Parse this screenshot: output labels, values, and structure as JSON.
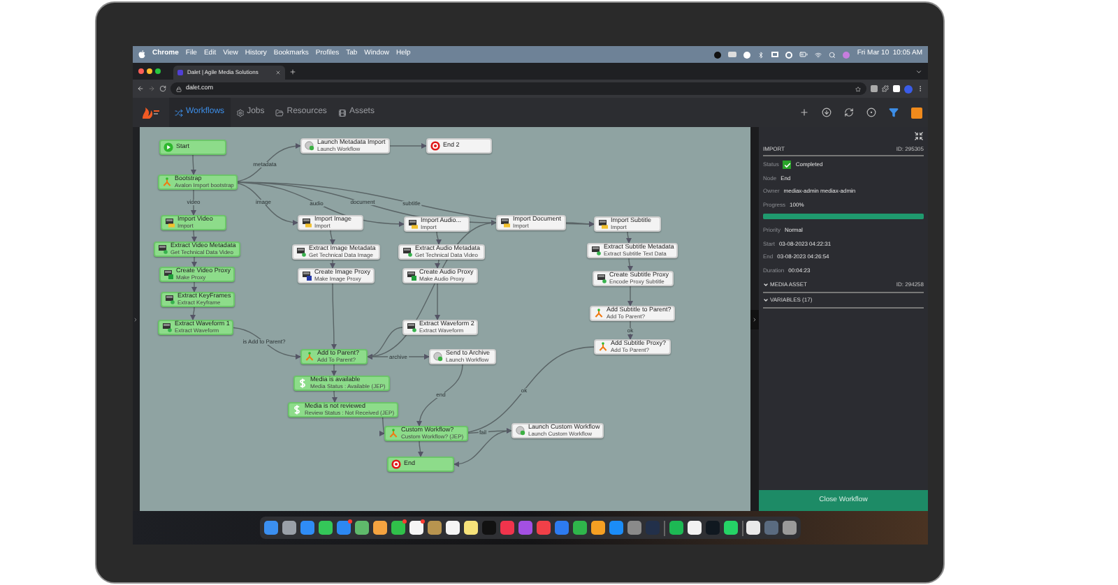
{
  "menu_bar": {
    "app": "Chrome",
    "items": [
      "File",
      "Edit",
      "View",
      "History",
      "Bookmarks",
      "Profiles",
      "Tab",
      "Window",
      "Help"
    ],
    "clock": "Fri Mar 10  10:05 AM"
  },
  "browser": {
    "tabs": [
      {
        "title": "Dalet | Agile Media Solutions",
        "selected": true
      }
    ],
    "url": "dalet.com"
  },
  "app_nav": [
    {
      "label": "Workflows",
      "kind": "workflows",
      "selected": true
    },
    {
      "label": "Jobs",
      "kind": "jobs",
      "selected": false
    },
    {
      "label": "Resources",
      "kind": "resources",
      "selected": false
    },
    {
      "label": "Assets",
      "kind": "assets",
      "selected": false
    }
  ],
  "workflow": {
    "nodes": [
      {
        "title": "Start",
        "kind": "start",
        "completed": true
      },
      {
        "title": "Bootstrap",
        "subtitle": "Avalon Import bootstrap",
        "kind": "decision",
        "completed": true
      },
      {
        "title": "Import Video",
        "subtitle": "Import",
        "kind": "import",
        "completed": true
      },
      {
        "title": "Extract Video Metadata",
        "subtitle": "Get Technical Data Video",
        "kind": "extract",
        "completed": true
      },
      {
        "title": "Create Video Proxy",
        "subtitle": "Make Proxy",
        "kind": "proxy",
        "completed": true
      },
      {
        "title": "Extract KeyFrames",
        "subtitle": "Extract Keyframe",
        "kind": "extract",
        "completed": true
      },
      {
        "title": "Extract Waveform 1",
        "subtitle": "Extract Waveform",
        "kind": "extract",
        "completed": true
      },
      {
        "title": "Add to Parent?",
        "subtitle": "Add To Parent?",
        "kind": "decision",
        "completed": true
      },
      {
        "title": "Media is available",
        "subtitle": "Media Status : Available (JEP)",
        "kind": "status",
        "completed": true
      },
      {
        "title": "Media is not reviewed",
        "subtitle": "Review Status : Not Received (JEP)",
        "kind": "status",
        "completed": true
      },
      {
        "title": "Custom Workflow?",
        "subtitle": "Custom Workflow? (JEP)",
        "kind": "decision",
        "completed": true
      },
      {
        "title": "End",
        "kind": "end",
        "completed": true
      },
      {
        "title": "Launch Metadata Import",
        "subtitle": "Launch Workflow",
        "kind": "launch",
        "completed": false
      },
      {
        "title": "End 2",
        "kind": "end",
        "completed": false
      },
      {
        "title": "Import Image",
        "subtitle": "Import",
        "kind": "import",
        "completed": false
      },
      {
        "title": "Extract Image Metadata",
        "subtitle": "Get Technical Data Image",
        "kind": "extract",
        "completed": false
      },
      {
        "title": "Create Image Proxy",
        "subtitle": "Make Image Proxy",
        "kind": "image_proxy",
        "completed": false
      },
      {
        "title": "Import Audio...",
        "subtitle": "Import",
        "kind": "import",
        "completed": false
      },
      {
        "title": "Extract Audio Metadata",
        "subtitle": "Get Technical Data Video",
        "kind": "extract",
        "completed": false
      },
      {
        "title": "Create Audio Proxy",
        "subtitle": "Make Audio Proxy",
        "kind": "proxy",
        "completed": false
      },
      {
        "title": "Extract Waveform 2",
        "subtitle": "Extract Waveform",
        "kind": "extract",
        "completed": false
      },
      {
        "title": "Send to Archive",
        "subtitle": "Launch Workflow",
        "kind": "launch",
        "completed": false
      },
      {
        "title": "Import Document",
        "subtitle": "Import",
        "kind": "import",
        "completed": false
      },
      {
        "title": "Import Subtitle",
        "subtitle": "Import",
        "kind": "import",
        "completed": false
      },
      {
        "title": "Extract Subtitle Metadata",
        "subtitle": "Extract Subtitle Text Data",
        "kind": "extract",
        "completed": false
      },
      {
        "title": "Create Subtitle Proxy",
        "subtitle": "Encode Proxy Subtitle",
        "kind": "extract",
        "completed": false
      },
      {
        "title": "Add Subtitle to Parent?",
        "subtitle": "Add To Parent?",
        "kind": "decision",
        "completed": false
      },
      {
        "title": "Add Subtitle Proxy?",
        "subtitle": "Add To Parent?",
        "kind": "decision",
        "completed": false
      },
      {
        "title": "Launch Custom Workflow",
        "subtitle": "Launch Custom Workflow",
        "kind": "launch",
        "completed": false
      }
    ],
    "edge_labels": [
      "metadata",
      "video",
      "image",
      "audio",
      "document",
      "subtitle",
      "is Add to Parent?",
      "ok",
      "ok",
      "archive",
      "end",
      "fail"
    ]
  },
  "details": {
    "section": "IMPORT",
    "id": "ID: 295305",
    "status_label": "Status",
    "status": "Completed",
    "rows": [
      {
        "label": "Node",
        "value": "End"
      },
      {
        "label": "Owner",
        "value": "mediax-admin mediax-admin"
      },
      {
        "label": "Progress",
        "value": "100%"
      }
    ],
    "progress": {
      "level": 1
    },
    "rows_after": [
      {
        "label": "Priority",
        "value": "Normal"
      },
      {
        "label": "Start",
        "value": "03-08-2023 04:22:31"
      },
      {
        "label": "End",
        "value": "03-08-2023 04:26:54"
      },
      {
        "label": "Duration",
        "value": "00:04:23"
      }
    ],
    "sections": [
      {
        "title": "MEDIA ASSET",
        "id": "ID: 294258"
      },
      {
        "title": "VARIABLES (17)"
      }
    ],
    "close_button": "Close Workflow"
  }
}
